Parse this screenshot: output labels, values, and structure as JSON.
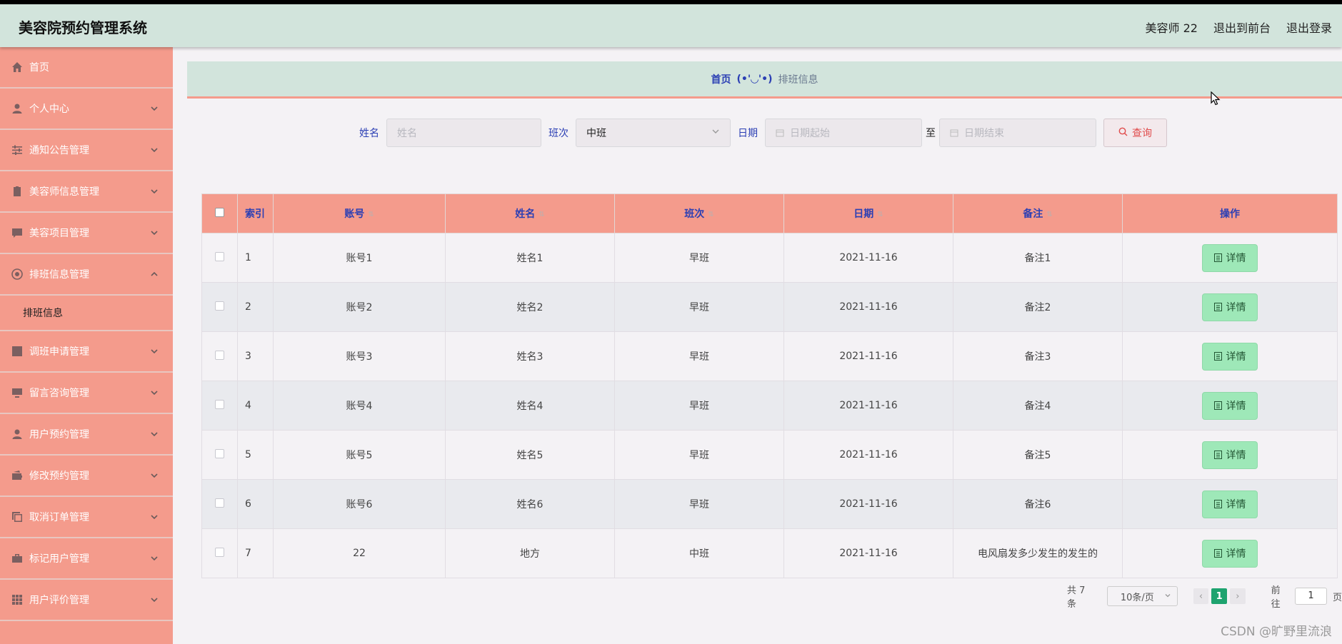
{
  "header": {
    "title": "美容院预约管理系统",
    "user": "美容师 22",
    "to_front": "退出到前台",
    "logout": "退出登录"
  },
  "sidebar": {
    "items": [
      {
        "label": "首页",
        "icon": "home-icon"
      },
      {
        "label": "个人中心",
        "icon": "user-icon"
      },
      {
        "label": "通知公告管理",
        "icon": "sliders-icon"
      },
      {
        "label": "美容师信息管理",
        "icon": "clipboard-icon"
      },
      {
        "label": "美容项目管理",
        "icon": "chat-icon"
      },
      {
        "label": "排班信息管理",
        "icon": "globe-icon"
      },
      {
        "label": "调班申请管理",
        "icon": "chart-icon"
      },
      {
        "label": "留言咨询管理",
        "icon": "monitor-icon"
      },
      {
        "label": "用户预约管理",
        "icon": "user-icon"
      },
      {
        "label": "修改预约管理",
        "icon": "wallet-icon"
      },
      {
        "label": "取消订单管理",
        "icon": "copy-icon"
      },
      {
        "label": "标记用户管理",
        "icon": "briefcase-icon"
      },
      {
        "label": "用户评价管理",
        "icon": "grid-icon"
      }
    ],
    "sub_item": "排班信息"
  },
  "breadcrumb": {
    "home": "首页",
    "sep": "(•'◡'•)",
    "current": "排班信息"
  },
  "search": {
    "name_label": "姓名",
    "name_placeholder": "姓名",
    "shift_label": "班次",
    "shift_value": "中班",
    "date_label": "日期",
    "date_start": "日期起始",
    "to": "至",
    "date_end": "日期结束",
    "query": "查询"
  },
  "table": {
    "headers": {
      "index": "索引",
      "account": "账号",
      "name": "姓名",
      "shift": "班次",
      "date": "日期",
      "note": "备注",
      "action": "操作"
    },
    "detail_label": "详情",
    "rows": [
      {
        "idx": "1",
        "account": "账号1",
        "name": "姓名1",
        "shift": "早班",
        "date": "2021-11-16",
        "note": "备注1"
      },
      {
        "idx": "2",
        "account": "账号2",
        "name": "姓名2",
        "shift": "早班",
        "date": "2021-11-16",
        "note": "备注2"
      },
      {
        "idx": "3",
        "account": "账号3",
        "name": "姓名3",
        "shift": "早班",
        "date": "2021-11-16",
        "note": "备注3"
      },
      {
        "idx": "4",
        "account": "账号4",
        "name": "姓名4",
        "shift": "早班",
        "date": "2021-11-16",
        "note": "备注4"
      },
      {
        "idx": "5",
        "account": "账号5",
        "name": "姓名5",
        "shift": "早班",
        "date": "2021-11-16",
        "note": "备注5"
      },
      {
        "idx": "6",
        "account": "账号6",
        "name": "姓名6",
        "shift": "早班",
        "date": "2021-11-16",
        "note": "备注6"
      },
      {
        "idx": "7",
        "account": "22",
        "name": "地方",
        "shift": "中班",
        "date": "2021-11-16",
        "note": "电风扇发多少发生的发生的"
      }
    ]
  },
  "pagination": {
    "total": "共 7 条",
    "page_size": "10条/页",
    "current_page": "1",
    "goto_label": "前往",
    "goto_value": "1",
    "page_unit": "页"
  },
  "watermark": "CSDN @旷野里流浪",
  "colors": {
    "sidebar": "#f49b8c",
    "header": "#d2e4dc",
    "accent_blue": "#2b3fb4",
    "detail_button": "#9ee8b8",
    "active_page": "#1ea36f"
  }
}
